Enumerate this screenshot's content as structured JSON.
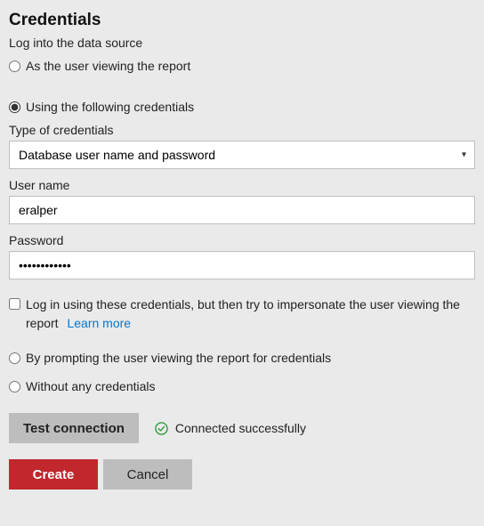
{
  "heading": "Credentials",
  "subtitle": "Log into the data source",
  "radios": {
    "as_user": "As the user viewing the report",
    "using_following": "Using the following credentials",
    "by_prompting": "By prompting the user viewing the report for credentials",
    "without": "Without any credentials",
    "selected": "using_following"
  },
  "type_label": "Type of credentials",
  "type_selected": "Database user name and password",
  "username_label": "User name",
  "username_value": "eralper",
  "password_label": "Password",
  "password_value": "••••••••••••",
  "impersonate_label": "Log in using these credentials, but then try to impersonate the user viewing the report",
  "learn_more": "Learn more",
  "test_button": "Test connection",
  "status_text": "Connected successfully",
  "create_button": "Create",
  "cancel_button": "Cancel"
}
